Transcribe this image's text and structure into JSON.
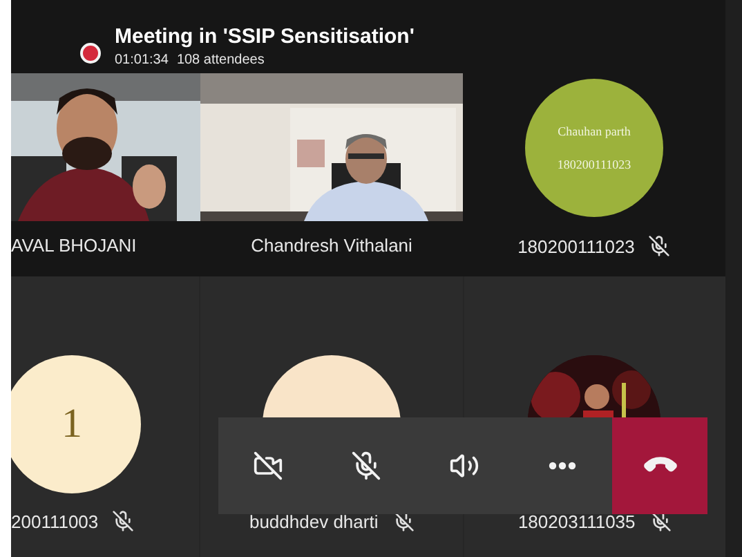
{
  "meeting": {
    "recording": true,
    "title": "Meeting in 'SSIP Sensitisation'",
    "duration": "01:01:34",
    "attendees": "108 attendees"
  },
  "participants": [
    {
      "kind": "video",
      "name": "AVAL BHOJANI",
      "muted": false
    },
    {
      "kind": "video",
      "name": "Chandresh Vithalani",
      "muted": false
    },
    {
      "kind": "initials",
      "name": "180200111023",
      "muted": true,
      "avatar_lines": [
        "Chauhan parth",
        "180200111023"
      ],
      "color": "#9cb23c"
    },
    {
      "kind": "initials",
      "name": "200111003",
      "muted": true,
      "avatar_lines": [
        "1"
      ],
      "color": "#fbeccb"
    },
    {
      "kind": "initials",
      "name": "buddhdev dharti",
      "muted": true,
      "color": "#f9e4c8"
    },
    {
      "name": "180203111035",
      "muted": true
    }
  ],
  "controls": [
    {
      "kind": "camera",
      "off": true
    },
    {
      "kind": "mic",
      "off": true
    },
    {
      "kind": "speaker"
    },
    {
      "kind": "more"
    },
    {
      "kind": "hangup"
    }
  ]
}
